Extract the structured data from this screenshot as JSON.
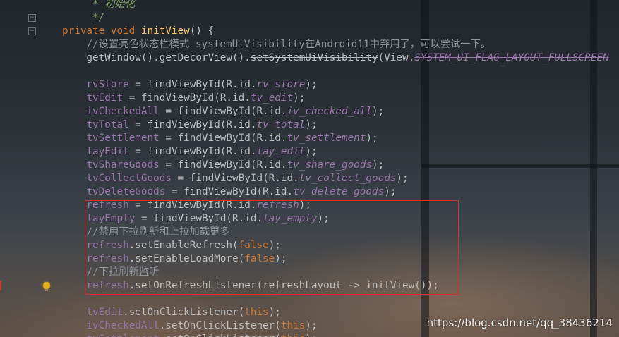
{
  "editor": {
    "lines": [
      [
        {
          "t": "     ",
          "c": "plain"
        },
        {
          "t": "* 初始化",
          "c": "doc"
        }
      ],
      [
        {
          "t": "     ",
          "c": "plain"
        },
        {
          "t": "*/",
          "c": "doc"
        }
      ],
      [
        {
          "t": "private void ",
          "c": "kw"
        },
        {
          "t": "initView",
          "c": "fn"
        },
        {
          "t": "() {",
          "c": "plain"
        }
      ],
      [
        {
          "t": "    ",
          "c": "plain"
        },
        {
          "t": "//设置亮色状态栏模式 systemUiVisibility在Android11中弃用了，可以尝试一下。",
          "c": "cmt"
        }
      ],
      [
        {
          "t": "    getWindow().getDecorView().",
          "c": "plain"
        },
        {
          "t": "setSystemUiVisibility",
          "c": "dep"
        },
        {
          "t": "(View.",
          "c": "plain"
        },
        {
          "t": "SYSTEM_UI_FLAG_LAYOUT_FULLSCREEN",
          "c": "depi"
        }
      ],
      [
        {
          "t": "",
          "c": "plain"
        }
      ],
      [
        {
          "t": "    ",
          "c": "plain"
        },
        {
          "t": "rvStore",
          "c": "fld"
        },
        {
          "t": " = findViewById(R.id.",
          "c": "plain"
        },
        {
          "t": "rv_store",
          "c": "fldi"
        },
        {
          "t": ");",
          "c": "plain"
        }
      ],
      [
        {
          "t": "    ",
          "c": "plain"
        },
        {
          "t": "tvEdit",
          "c": "fld"
        },
        {
          "t": " = findViewById(R.id.",
          "c": "plain"
        },
        {
          "t": "tv_edit",
          "c": "fldi"
        },
        {
          "t": ");",
          "c": "plain"
        }
      ],
      [
        {
          "t": "    ",
          "c": "plain"
        },
        {
          "t": "ivCheckedAll",
          "c": "fld"
        },
        {
          "t": " = findViewById(R.id.",
          "c": "plain"
        },
        {
          "t": "iv_checked_all",
          "c": "fldi"
        },
        {
          "t": ");",
          "c": "plain"
        }
      ],
      [
        {
          "t": "    ",
          "c": "plain"
        },
        {
          "t": "tvTotal",
          "c": "fld"
        },
        {
          "t": " = findViewById(R.id.",
          "c": "plain"
        },
        {
          "t": "tv_total",
          "c": "fldi"
        },
        {
          "t": ");",
          "c": "plain"
        }
      ],
      [
        {
          "t": "    ",
          "c": "plain"
        },
        {
          "t": "tvSettlement",
          "c": "fld"
        },
        {
          "t": " = findViewById(R.id.",
          "c": "plain"
        },
        {
          "t": "tv_settlement",
          "c": "fldi"
        },
        {
          "t": ");",
          "c": "plain"
        }
      ],
      [
        {
          "t": "    ",
          "c": "plain"
        },
        {
          "t": "layEdit",
          "c": "fld"
        },
        {
          "t": " = findViewById(R.id.",
          "c": "plain"
        },
        {
          "t": "lay_edit",
          "c": "fldi"
        },
        {
          "t": ");",
          "c": "plain"
        }
      ],
      [
        {
          "t": "    ",
          "c": "plain"
        },
        {
          "t": "tvShareGoods",
          "c": "fld"
        },
        {
          "t": " = findViewById(R.id.",
          "c": "plain"
        },
        {
          "t": "tv_share_goods",
          "c": "fldi"
        },
        {
          "t": ");",
          "c": "plain"
        }
      ],
      [
        {
          "t": "    ",
          "c": "plain"
        },
        {
          "t": "tvCollectGoods",
          "c": "fld"
        },
        {
          "t": " = findViewById(R.id.",
          "c": "plain"
        },
        {
          "t": "tv_collect_goods",
          "c": "fldi"
        },
        {
          "t": ");",
          "c": "plain"
        }
      ],
      [
        {
          "t": "    ",
          "c": "plain"
        },
        {
          "t": "tvDeleteGoods",
          "c": "fld"
        },
        {
          "t": " = findViewById(R.id.",
          "c": "plain"
        },
        {
          "t": "tv_delete_goods",
          "c": "fldi"
        },
        {
          "t": ");",
          "c": "plain"
        }
      ],
      [
        {
          "t": "    ",
          "c": "plain"
        },
        {
          "t": "refresh",
          "c": "fld"
        },
        {
          "t": " = findViewById(R.id.",
          "c": "plain"
        },
        {
          "t": "refresh",
          "c": "fldi"
        },
        {
          "t": ");",
          "c": "plain"
        }
      ],
      [
        {
          "t": "    ",
          "c": "plain"
        },
        {
          "t": "layEmpty",
          "c": "fld"
        },
        {
          "t": " = findViewById(R.id.",
          "c": "plain"
        },
        {
          "t": "lay_empty",
          "c": "fldi"
        },
        {
          "t": ");",
          "c": "plain"
        }
      ],
      [
        {
          "t": "    ",
          "c": "plain"
        },
        {
          "t": "//禁用下拉刷新和上拉加载更多",
          "c": "cmt"
        }
      ],
      [
        {
          "t": "    ",
          "c": "plain"
        },
        {
          "t": "refresh",
          "c": "fld"
        },
        {
          "t": ".setEnableRefresh(",
          "c": "plain"
        },
        {
          "t": "false",
          "c": "kw"
        },
        {
          "t": ");",
          "c": "plain"
        }
      ],
      [
        {
          "t": "    ",
          "c": "plain"
        },
        {
          "t": "refresh",
          "c": "fld"
        },
        {
          "t": ".setEnableLoadMore(",
          "c": "plain"
        },
        {
          "t": "false",
          "c": "kw"
        },
        {
          "t": ");",
          "c": "plain"
        }
      ],
      [
        {
          "t": "    ",
          "c": "plain"
        },
        {
          "t": "//下拉刷新监听",
          "c": "cmt"
        }
      ],
      [
        {
          "t": "    ",
          "c": "plain"
        },
        {
          "t": "refresh",
          "c": "fld"
        },
        {
          "t": ".setOnRefreshListener(refreshLayout -> initView());",
          "c": "plain"
        }
      ],
      [
        {
          "t": "",
          "c": "plain"
        }
      ],
      [
        {
          "t": "    ",
          "c": "plain"
        },
        {
          "t": "tvEdit",
          "c": "fld"
        },
        {
          "t": ".setOnClickListener(",
          "c": "plain"
        },
        {
          "t": "this",
          "c": "kw"
        },
        {
          "t": ");",
          "c": "plain"
        }
      ],
      [
        {
          "t": "    ",
          "c": "plain"
        },
        {
          "t": "ivCheckedAll",
          "c": "fld"
        },
        {
          "t": ".setOnClickListener(",
          "c": "plain"
        },
        {
          "t": "this",
          "c": "kw"
        },
        {
          "t": ");",
          "c": "plain"
        }
      ],
      [
        {
          "t": "    ",
          "c": "plain"
        },
        {
          "t": "tvSettlement",
          "c": "fld"
        },
        {
          "t": ".setOnClickListener(",
          "c": "plain"
        },
        {
          "t": "this",
          "c": "kw"
        },
        {
          "t": ");",
          "c": "plain"
        }
      ]
    ]
  },
  "gutter": {
    "fold_icons": [
      "fold-toggle-icon",
      "fold-toggle-icon"
    ],
    "intention_icon": "lightbulb-icon"
  },
  "overlay": {
    "watermark": "https://blog.csdn.net/qq_38436214",
    "highlight_color": "#d62c2c"
  },
  "theme": {
    "keyword": "#cc7832",
    "method": "#ffc66d",
    "field": "#9876aa",
    "comment": "#8d949b",
    "doc_comment": "#7fa05f",
    "text": "#bbbdbe"
  }
}
